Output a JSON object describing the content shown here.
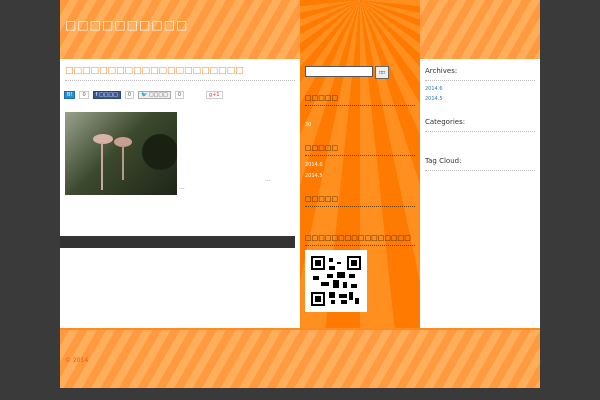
{
  "site": {
    "title": "□□□□□□□□□□",
    "copyright": "© 2014"
  },
  "post": {
    "title": "□□□□□□□□□□□□□□□□□□□□□",
    "share": {
      "b_count": "0",
      "facebook_label": "□□□□",
      "facebook_count": "0",
      "tweet_label": "□□□□",
      "tweet_count": "0",
      "gplus_label": "g+1"
    },
    "excerpt_more": "...",
    "excerpt_tail": "..."
  },
  "center": {
    "search_button": "□□",
    "w1_title": "□□□□□",
    "w1_value": "30",
    "w2_title": "□□□□□",
    "w2_items": [
      "2014.6",
      "2014.5"
    ],
    "w3_title": "□□□□□",
    "w4_title": "□□□□□□□□□□□□□□□□"
  },
  "right": {
    "archives_title": "Archives:",
    "archives": [
      "2014.6",
      "2014.5"
    ],
    "categories_title": "Categories:",
    "tag_title": "Tag Cloud:"
  }
}
